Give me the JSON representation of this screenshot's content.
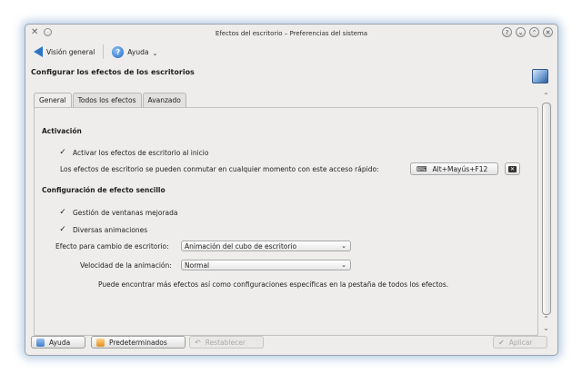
{
  "window": {
    "title": "Efectos del escritorio – Preferencias del sistema",
    "title_buttons": [
      "?",
      "⌄",
      "⌃",
      "✕"
    ]
  },
  "toolbar": {
    "overview_label": "Visión general",
    "help_label": "Ayuda"
  },
  "page": {
    "header": "Configurar los efectos de los escritorios"
  },
  "tabs": [
    {
      "label": "General",
      "active": true
    },
    {
      "label": "Todos los efectos",
      "active": false
    },
    {
      "label": "Avanzado",
      "active": false
    }
  ],
  "activation": {
    "section_title": "Activación",
    "enable_effects_label": "Activar los efectos de escritorio al inicio",
    "enable_effects_checked": true,
    "shortcut_text": "Los efectos de escritorio se pueden conmutar en cualquier momento con este acceso rápido:",
    "shortcut_value": "Alt+Mayús+F12"
  },
  "simple": {
    "section_title": "Configuración de efecto sencillo",
    "window_mgmt_label": "Gestión de ventanas mejorada",
    "window_mgmt_checked": true,
    "animations_label": "Diversas animaciones",
    "animations_checked": true,
    "desktop_switch_label": "Efecto para cambio de escritorio:",
    "desktop_switch_value": "Animación del cubo de escritorio",
    "speed_label": "Velocidad de la animación:",
    "speed_value": "Normal",
    "info_text": "Puede encontrar más efectos así como configuraciones específicas en la pestaña de todos los efectos."
  },
  "buttons": {
    "help": "Ayuda",
    "defaults": "Predeterminados",
    "reset": "Restablecer",
    "apply": "Aplicar"
  },
  "icons": {
    "app": "tools-icon",
    "back": "back-arrow-icon",
    "help": "help-icon",
    "keyboard": "keyboard-icon",
    "clear": "clear-icon"
  },
  "colors": {
    "accent": "#2d74c5",
    "window_bg": "#eeedeb",
    "glow": "#5a8cbe"
  }
}
